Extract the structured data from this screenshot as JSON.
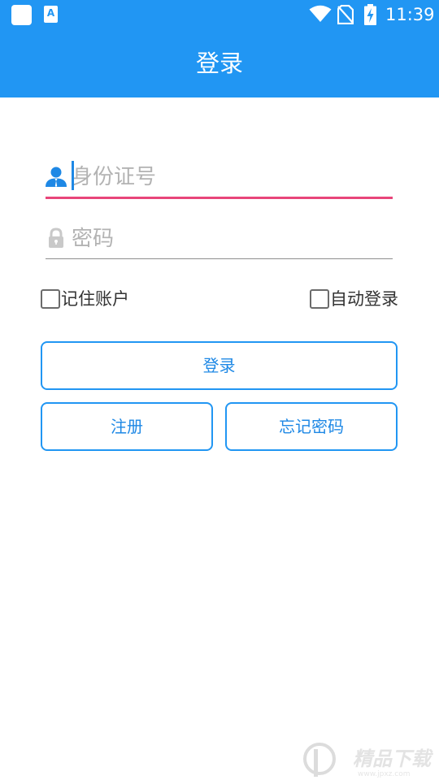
{
  "status_bar": {
    "time": "11:39",
    "app_icon_letter": "A",
    "icons": [
      "notification-square-icon",
      "app-notification-icon",
      "wifi-icon",
      "no-sim-icon",
      "battery-charging-icon"
    ]
  },
  "header": {
    "title": "登录"
  },
  "form": {
    "id_field": {
      "placeholder": "身份证号",
      "value": "",
      "icon": "user-icon"
    },
    "password_field": {
      "placeholder": "密码",
      "value": "",
      "icon": "lock-icon"
    },
    "remember_account": {
      "label": "记住账户",
      "checked": false
    },
    "auto_login": {
      "label": "自动登录",
      "checked": false
    }
  },
  "buttons": {
    "login": "登录",
    "register": "注册",
    "forgot_password": "忘记密码"
  },
  "colors": {
    "primary": "#2196f3",
    "focus_underline": "#e8457a",
    "placeholder": "#b3b3b3"
  },
  "watermark": {
    "text": "精品下载",
    "site": "www.jpxz.com"
  }
}
